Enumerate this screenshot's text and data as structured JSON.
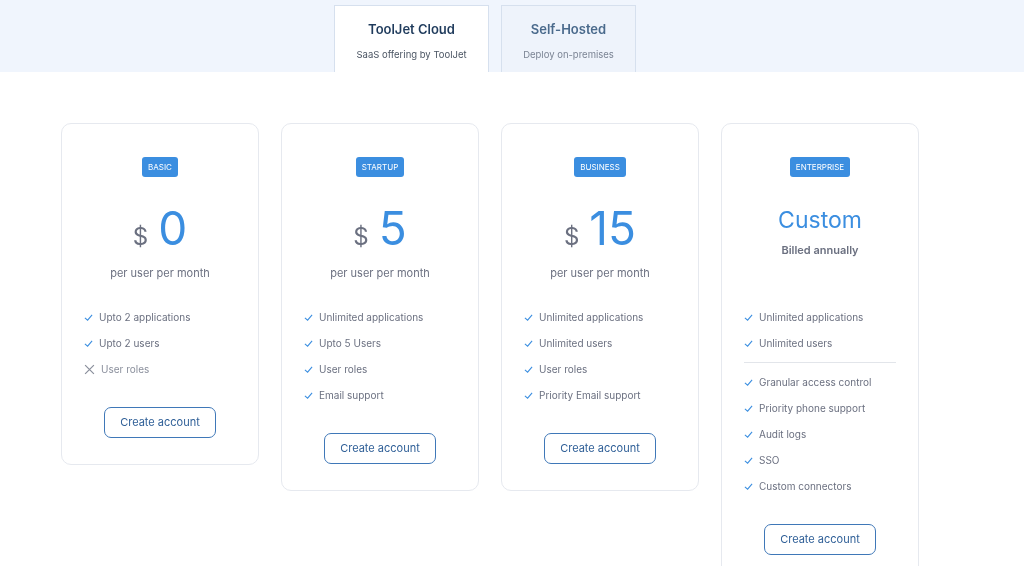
{
  "tabs": [
    {
      "title": "ToolJet Cloud",
      "subtitle": "SaaS offering by ToolJet",
      "selected": true
    },
    {
      "title": "Self-Hosted",
      "subtitle": "Deploy on-premises",
      "selected": false
    }
  ],
  "plans": [
    {
      "badge": "BASIC",
      "price": {
        "kind": "amount",
        "currency": "$",
        "value": "0"
      },
      "caption": "per user per month",
      "feature_groups": [
        [
          {
            "text": "Upto 2 applications",
            "included": true
          },
          {
            "text": "Upto 2 users",
            "included": true
          },
          {
            "text": "User roles",
            "included": false
          }
        ]
      ],
      "button": "Create account"
    },
    {
      "badge": "STARTUP",
      "price": {
        "kind": "amount",
        "currency": "$",
        "value": "5"
      },
      "caption": "per user per month",
      "feature_groups": [
        [
          {
            "text": "Unlimited applications",
            "included": true
          },
          {
            "text": "Upto 5 Users",
            "included": true
          },
          {
            "text": "User roles",
            "included": true
          },
          {
            "text": "Email support",
            "included": true
          }
        ]
      ],
      "button": "Create account"
    },
    {
      "badge": "BUSINESS",
      "price": {
        "kind": "amount",
        "currency": "$",
        "value": "15"
      },
      "caption": "per user per month",
      "feature_groups": [
        [
          {
            "text": "Unlimited applications",
            "included": true
          },
          {
            "text": "Unlimited users",
            "included": true
          },
          {
            "text": "User roles",
            "included": true
          },
          {
            "text": "Priority Email support",
            "included": true
          }
        ]
      ],
      "button": "Create account"
    },
    {
      "badge": "ENTERPRISE",
      "price": {
        "kind": "custom",
        "value": "Custom"
      },
      "caption": "Billed annually",
      "feature_groups": [
        [
          {
            "text": "Unlimited applications",
            "included": true
          },
          {
            "text": "Unlimited users",
            "included": true
          }
        ],
        [
          {
            "text": "Granular access control",
            "included": true
          },
          {
            "text": "Priority phone support",
            "included": true
          },
          {
            "text": "Audit logs",
            "included": true
          },
          {
            "text": "SSO",
            "included": true
          },
          {
            "text": "Custom connectors",
            "included": true
          }
        ]
      ],
      "button": "Create account"
    }
  ]
}
